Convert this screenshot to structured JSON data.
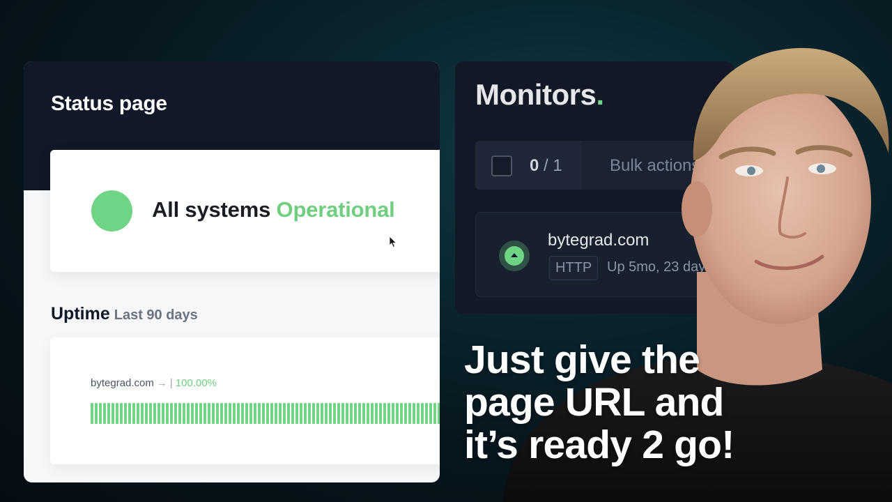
{
  "status_page": {
    "title": "Status page",
    "systems_prefix": "All systems ",
    "systems_status": "Operational",
    "status_color": "#6fd584",
    "uptime_label": "Uptime",
    "uptime_range": "Last 90 days",
    "site": "bytegrad.com",
    "site_arrow": "→",
    "separator": "|",
    "uptime_percent": "100.00%",
    "uptime_bars": {
      "days_visible": 87,
      "all_up": true,
      "bar_color": "#6fd584"
    }
  },
  "monitors": {
    "title": "Monitors",
    "title_dot": ".",
    "selected_count": "0",
    "count_separator": " / ",
    "total_count": "1",
    "bulk_actions_label": "Bulk actions",
    "item": {
      "name": "bytegrad.com",
      "protocol": "HTTP",
      "uptime": "Up 5mo, 23 day"
    }
  },
  "caption": {
    "line1": "Just give the",
    "line2": "page URL and",
    "line3": "it’s ready 2 go!"
  }
}
